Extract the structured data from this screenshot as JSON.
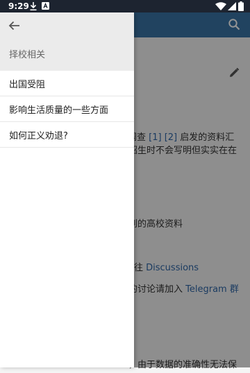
{
  "status_bar": {
    "time": "9:29",
    "icons": [
      "download-icon",
      "a-box-icon",
      "wifi-icon",
      "signal-icon",
      "battery-icon"
    ]
  },
  "app_bar": {
    "color": "#3a74a6",
    "icons": [
      "search-icon"
    ]
  },
  "background_content": {
    "line1_prefix": "的调查 ",
    "ref1": "[1]",
    "ref2": "[2]",
    "line1_suffix": " 启发的资料汇",
    "line2": "招生时不会写明但实实在在",
    "line3": "到的高校资料",
    "line4_prefix": "往 ",
    "line4_link": "Discussions",
    "line5_prefix": "的讨论请加入 ",
    "line5_link": "Telegram 群",
    "line6": "，由于数据的准确性无法保"
  },
  "drawer": {
    "back_icon": "arrow-left-icon",
    "section_title": "择校相关",
    "items": [
      {
        "label": "出国受阻"
      },
      {
        "label": "影响生活质量的一些方面"
      },
      {
        "label": "如何正义劝退?"
      }
    ]
  }
}
